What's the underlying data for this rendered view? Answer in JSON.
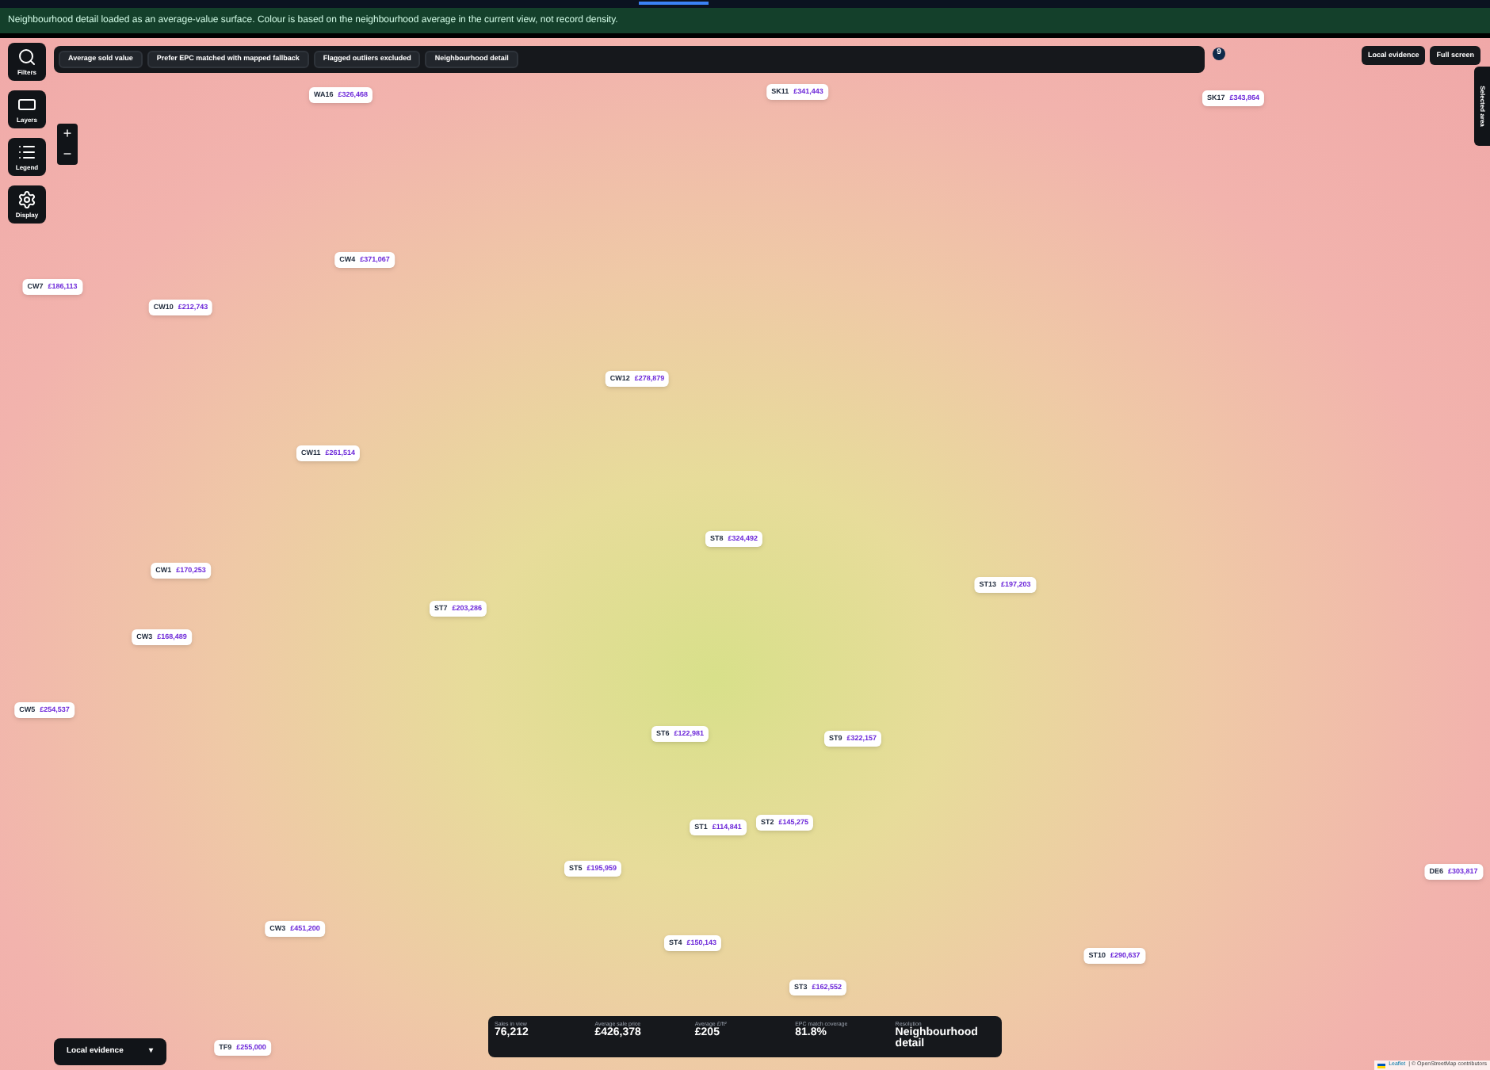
{
  "banner": {
    "text": "Neighbourhood detail loaded as an average-value surface. Colour is based on the neighbourhood average in the current view, not record density."
  },
  "tools": [
    {
      "label": "Filters",
      "kind": "filters"
    },
    {
      "label": "Layers",
      "kind": "layers"
    },
    {
      "label": "Legend",
      "kind": "legend"
    },
    {
      "label": "Display",
      "kind": "display"
    }
  ],
  "zoom": {
    "in": "+",
    "out": "−"
  },
  "chips": [
    "Average sold value",
    "Prefer EPC matched with mapped fallback",
    "Flagged outliers excluded",
    "Neighbourhood detail"
  ],
  "cluster_marker": "9",
  "top_right_buttons": [
    "Local evidence",
    "Full screen"
  ],
  "side_tab": "Selected area",
  "pins": [
    {
      "code": "WA16",
      "price": "£326,468"
    },
    {
      "code": "SK11",
      "price": "£341,443"
    },
    {
      "code": "SK17",
      "price": "£343,864"
    },
    {
      "code": "CW7",
      "price": "£186,113"
    },
    {
      "code": "CW4",
      "price": "£371,067"
    },
    {
      "code": "CW10",
      "price": "£212,743"
    },
    {
      "code": "CW12",
      "price": "£278,879"
    },
    {
      "code": "CW11",
      "price": "£261,514"
    },
    {
      "code": "ST8",
      "price": "£324,492"
    },
    {
      "code": "CW1",
      "price": "£170,253"
    },
    {
      "code": "ST13",
      "price": "£197,203"
    },
    {
      "code": "ST7",
      "price": "£203,286"
    },
    {
      "code": "CW3",
      "price": "£168,489"
    },
    {
      "code": "CW5",
      "price": "£254,537"
    },
    {
      "code": "ST6",
      "price": "£122,981"
    },
    {
      "code": "ST9",
      "price": "£322,157"
    },
    {
      "code": "ST1",
      "price": "£114,841"
    },
    {
      "code": "ST2",
      "price": "£145,275"
    },
    {
      "code": "ST5",
      "price": "£195,959"
    },
    {
      "code": "DE6",
      "price": "£303,817"
    },
    {
      "code": "CW3",
      "price": "£451,200"
    },
    {
      "code": "ST4",
      "price": "£150,143"
    },
    {
      "code": "ST10",
      "price": "£290,637"
    },
    {
      "code": "ST3",
      "price": "£162,552"
    },
    {
      "code": "TF9",
      "price": "£255,000"
    }
  ],
  "evidence_dropdown": {
    "label": "Local evidence",
    "caret": "▾"
  },
  "stats": [
    {
      "label": "Sales in view",
      "value": "76,212"
    },
    {
      "label": "Average sale price",
      "value": "£426,378"
    },
    {
      "label": "Average £/ft²",
      "value": "£205"
    },
    {
      "label": "EPC match coverage",
      "value": "81.8%"
    },
    {
      "label": "Resolution",
      "value": "Neighbourhood detail"
    }
  ],
  "attribution": {
    "link": "Leaflet",
    "text": "| © OpenStreetMap contributors"
  }
}
